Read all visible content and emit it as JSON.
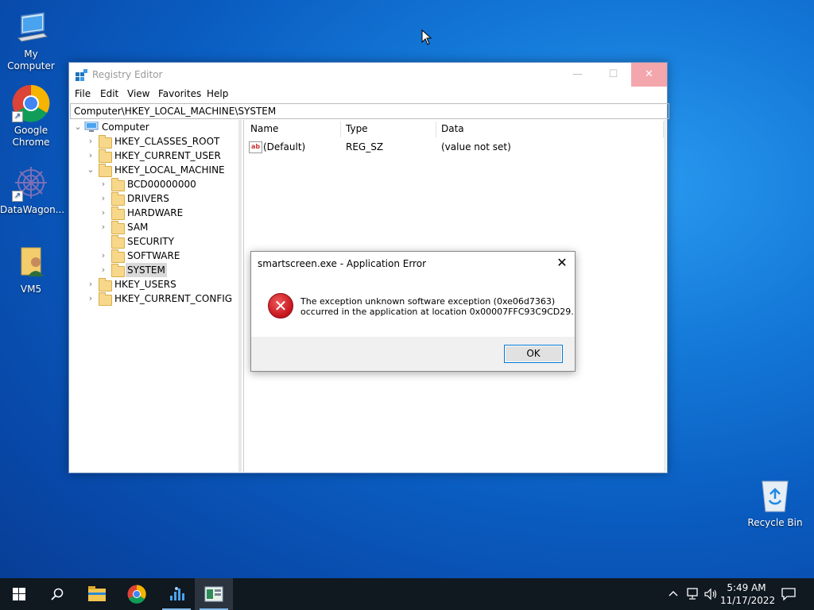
{
  "desktop": {
    "icons": [
      {
        "label": "My Computer"
      },
      {
        "label": "Google Chrome"
      },
      {
        "label": "DataWagon..."
      },
      {
        "label": "VM5"
      },
      {
        "label": "Recycle Bin"
      }
    ]
  },
  "registry_window": {
    "title": "Registry Editor",
    "menu": [
      "File",
      "Edit",
      "View",
      "Favorites",
      "Help"
    ],
    "address": "Computer\\HKEY_LOCAL_MACHINE\\SYSTEM",
    "tree": {
      "root": "Computer",
      "hives": [
        "HKEY_CLASSES_ROOT",
        "HKEY_CURRENT_USER",
        "HKEY_LOCAL_MACHINE",
        "HKEY_USERS",
        "HKEY_CURRENT_CONFIG"
      ],
      "hklm_children": [
        "BCD00000000",
        "DRIVERS",
        "HARDWARE",
        "SAM",
        "SECURITY",
        "SOFTWARE",
        "SYSTEM"
      ],
      "selected": "SYSTEM"
    },
    "columns": [
      "Name",
      "Type",
      "Data"
    ],
    "values": [
      {
        "name": "(Default)",
        "type": "REG_SZ",
        "data": "(value not set)"
      }
    ]
  },
  "error_dialog": {
    "title": "smartscreen.exe - Application Error",
    "message_line1": "The exception unknown software exception (0xe06d7363)",
    "message_line2": "occurred in the application at location 0x00007FFC93C9CD29.",
    "ok_label": "OK"
  },
  "taskbar": {
    "time": "5:49 AM",
    "date": "11/17/2022",
    "icons": [
      "start-icon",
      "search-icon",
      "file-explorer-icon",
      "chrome-icon",
      "datawagon-icon",
      "registry-editor-icon"
    ]
  },
  "colors": {
    "accent": "#0078d7",
    "close_hover": "#f4a6ad",
    "error_red": "#c4141c",
    "taskbar": "#101820"
  }
}
